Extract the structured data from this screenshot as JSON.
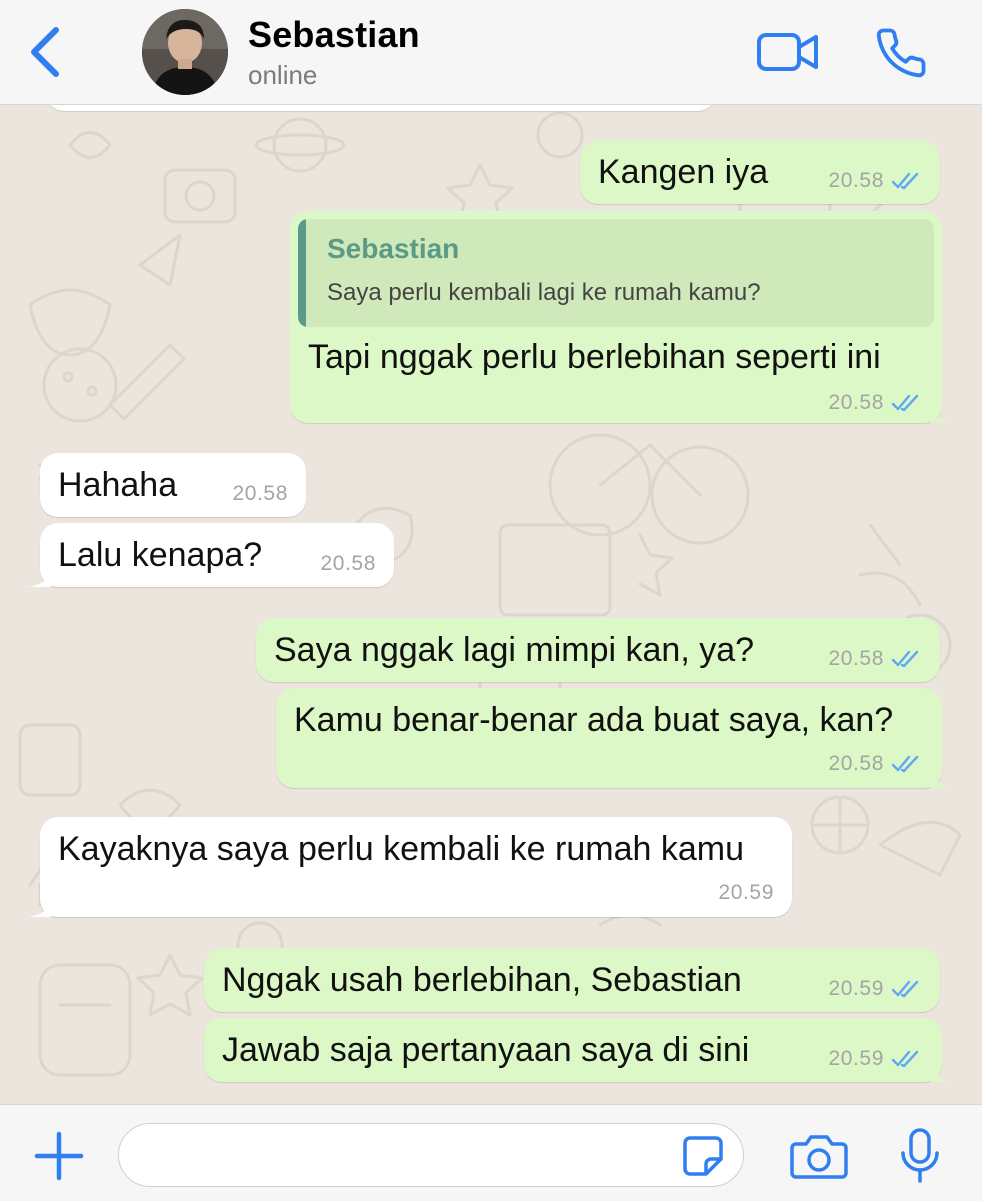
{
  "header": {
    "contact_name": "Sebastian",
    "status": "online"
  },
  "messages": [
    {
      "dir": "out",
      "text": "Kangen iya",
      "time": "20.58",
      "read": true
    },
    {
      "dir": "out",
      "text": "Tapi nggak perlu berlebihan seperti ini",
      "time": "20.58",
      "read": true,
      "reply_to": {
        "name": "Sebastian",
        "text": "Saya perlu kembali lagi ke rumah kamu?"
      }
    },
    {
      "dir": "in",
      "text": "Hahaha",
      "time": "20.58"
    },
    {
      "dir": "in",
      "text": "Lalu kenapa?",
      "time": "20.58"
    },
    {
      "dir": "out",
      "text": "Saya nggak lagi mimpi kan, ya?",
      "time": "20.58",
      "read": true
    },
    {
      "dir": "out",
      "text": "Kamu benar-benar ada buat saya, kan?",
      "time": "20.58",
      "read": true
    },
    {
      "dir": "in",
      "text": "Kayaknya saya perlu kembali ke rumah kamu",
      "time": "20.59"
    },
    {
      "dir": "out",
      "text": "Nggak usah berlebihan, Sebastian",
      "time": "20.59",
      "read": true
    },
    {
      "dir": "out",
      "text": "Jawab saja pertanyaan saya di sini",
      "time": "20.59",
      "read": true
    }
  ],
  "composer": {
    "value": ""
  },
  "colors": {
    "accent": "#2f7ff0",
    "outgoing_bubble": "#dcf8c6",
    "incoming_bubble": "#ffffff",
    "quote_name": "#5a9a86",
    "read_ticks": "#5fa8f5",
    "background": "#ece5dd"
  },
  "icons": {
    "back": "chevron-left-icon",
    "video": "video-camera-icon",
    "call": "phone-icon",
    "attach": "plus-icon",
    "sticker": "sticker-icon",
    "camera": "camera-icon",
    "mic": "microphone-icon",
    "read": "double-check-icon"
  }
}
